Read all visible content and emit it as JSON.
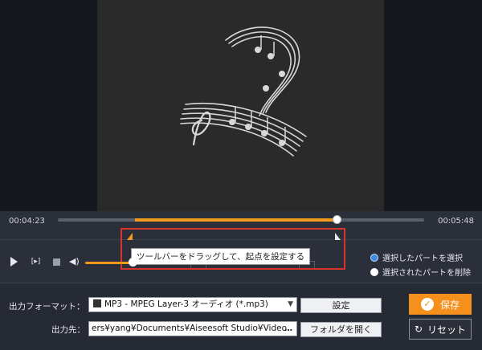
{
  "timeline": {
    "current_time": "00:04:23",
    "end_time": "00:05:48",
    "selection_start_fraction": 0.21,
    "selection_end_fraction": 0.76,
    "playhead_fraction": 0.76
  },
  "trim": {
    "tooltip": "ツールバーをドラッグして、起点を設定する"
  },
  "controls": {
    "volume_fraction": 0.95
  },
  "options": {
    "keep_selected": "選択したパートを選択",
    "delete_selected": "選択されたパートを削除"
  },
  "output": {
    "format_label": "出力フォーマット：",
    "format_value": "MP3 - MPEG Layer-3 オーディオ (*.mp3)",
    "settings_button": "設定",
    "path_label": "出力先：",
    "path_value": "ers¥yang¥Documents¥Aiseesoft Studio¥Video",
    "browse_button": "…",
    "open_folder_button": "フォルダを開く",
    "save_button": "保存",
    "reset_button": "リセット"
  },
  "colors": {
    "accent": "#f39a1e",
    "highlight_border": "#d9342b",
    "radio_selected": "#3d8ee8"
  }
}
